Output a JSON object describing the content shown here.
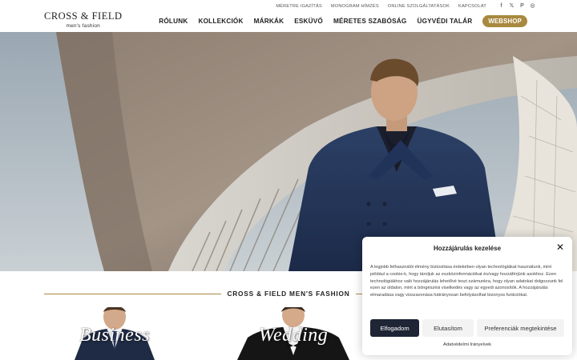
{
  "logo": {
    "main": "CROSS & FIELD",
    "sub": "men's fashion"
  },
  "topbar": {
    "links": [
      "MÉRETRE IGAZÍTÁS",
      "MONOGRAM HÍMZÉS",
      "ONLINE SZOLGÁLTATÁSOK",
      "KAPCSOLAT"
    ],
    "social": [
      {
        "icon": "facebook-icon",
        "glyph": "f"
      },
      {
        "icon": "x-icon",
        "glyph": "𝕏"
      },
      {
        "icon": "pinterest-icon",
        "glyph": "P"
      },
      {
        "icon": "instagram-icon",
        "glyph": "◎"
      }
    ]
  },
  "nav": {
    "items": [
      "RÓLUNK",
      "KOLLEKCIÓK",
      "MÁRKÁK",
      "ESKÜVŐ",
      "MÉRETES SZABÓSÁG",
      "ÜGYVÉDI TALÁR"
    ],
    "webshop": "WEBSHOP"
  },
  "section": {
    "title": "CROSS & FIELD MEN'S FASHION"
  },
  "collections": [
    {
      "caption": "Business"
    },
    {
      "caption": "Wedding"
    }
  ],
  "cookie": {
    "title": "Hozzájárulás kezelése",
    "body": "A legjobb felhasználói élmény biztosítása érdekében olyan technológiákat használunk, mint például a cookie-k, hogy tároljuk az eszközinformációkat és/vagy hozzáférjünk azokhoz. Ezen technológiákhoz való hozzájárulás lehetővé teszi számunkra, hogy olyan adatokat dolgozzunk fel ezen az oldalon, mint a böngészési viselkedés vagy az egyedi azonosítók. A hozzájárulás elmaradása vagy visszavonása hátrányosan befolyásolhat bizonyos funkciókat.",
    "accept": "Elfogadom",
    "deny": "Elutasítom",
    "prefs": "Preferenciák megtekintése",
    "policy": "Adatvédelmi Irányelvek"
  },
  "colors": {
    "accent": "#a8893f",
    "primary_button": "#1e2535"
  }
}
